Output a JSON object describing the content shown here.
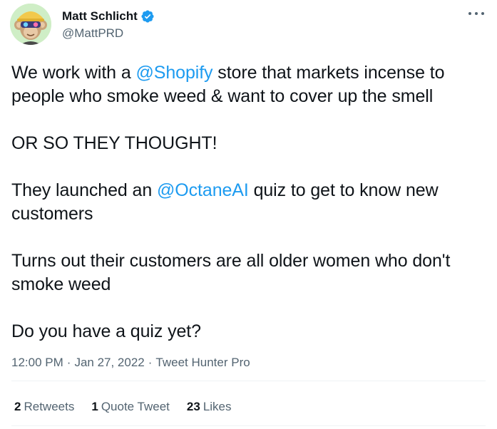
{
  "author": {
    "display_name": "Matt Schlicht",
    "handle": "@MattPRD",
    "verified": true,
    "avatar_icon": "cartoon-monkey-avatar-icon"
  },
  "tweet": {
    "line1_pre": "We work with a ",
    "mention_shopify": "@Shopify",
    "line1_post": " store that markets incense to people who smoke weed & want to cover up the smell",
    "line2": "OR SO THEY THOUGHT!",
    "line3_pre": "They launched an ",
    "mention_octane": "@OctaneAI",
    "line3_post": " quiz to get to know new customers",
    "line4": "Turns out their customers are all older women who don't smoke weed",
    "line5": "Do you have a quiz yet?"
  },
  "meta": {
    "time": "12:00 PM",
    "separator": "·",
    "date": "Jan 27, 2022",
    "source": "Tweet Hunter Pro"
  },
  "stats": {
    "retweets_count": "2",
    "retweets_label": "Retweets",
    "quotes_count": "1",
    "quotes_label": "Quote Tweet",
    "likes_count": "23",
    "likes_label": "Likes"
  },
  "colors": {
    "link": "#1d9bf0",
    "secondary_text": "#536471",
    "primary_text": "#0f1419",
    "divider": "#eff3f4"
  }
}
